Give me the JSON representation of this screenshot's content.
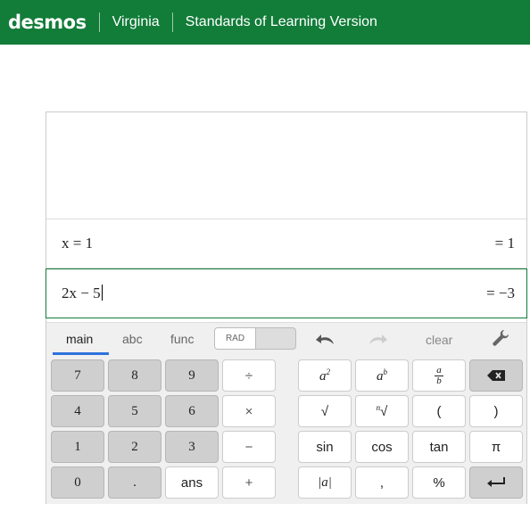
{
  "header": {
    "logo": "desmos",
    "region": "Virginia",
    "version": "Standards of Learning Version"
  },
  "expressions": [
    {
      "expr": "x = 1",
      "result": "= 1"
    },
    {
      "expr": "2x − 5",
      "result": "= −3"
    }
  ],
  "keypad": {
    "tabs": [
      "main",
      "abc",
      "func"
    ],
    "rad_label": "RAD",
    "clear_label": "clear",
    "keys": {
      "k7": "7",
      "k8": "8",
      "k9": "9",
      "div": "÷",
      "k4": "4",
      "k5": "5",
      "k6": "6",
      "mul": "×",
      "k1": "1",
      "k2": "2",
      "k3": "3",
      "minus": "−",
      "k0": "0",
      "dot": ".",
      "ans": "ans",
      "plus": "+",
      "sqrt": "√",
      "paren_open": "(",
      "paren_close": ")",
      "sin": "sin",
      "cos": "cos",
      "tan": "tan",
      "pi": "π",
      "abs": "|a|",
      "comma": ",",
      "percent": "%"
    }
  },
  "colors": {
    "header": "#127c39",
    "active_border": "#127c39",
    "tab_underline": "#2f72dc"
  }
}
